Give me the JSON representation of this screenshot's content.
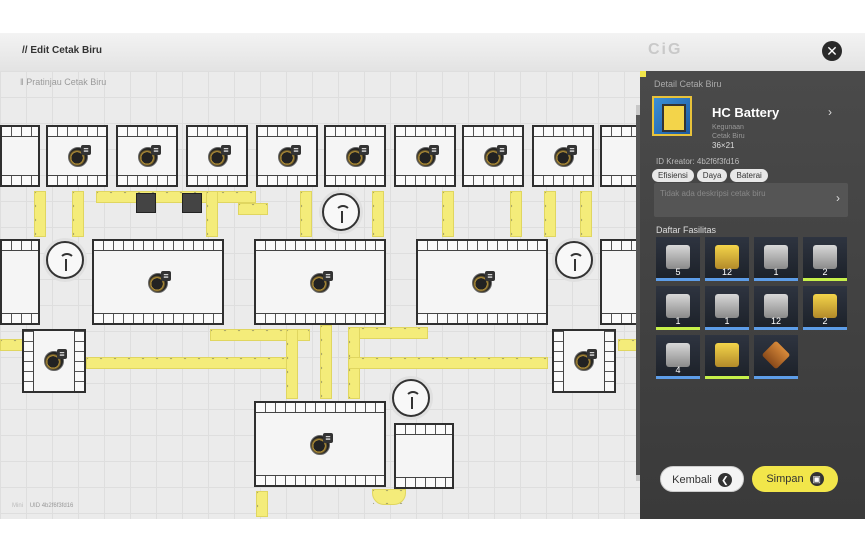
{
  "header": {
    "title": "// Edit Cetak Biru",
    "logo_text": "CiG",
    "close_label": "✕"
  },
  "canvas": {
    "preview_label": "‖ Pratinjau Cetak Biru"
  },
  "details": {
    "section_label": "Detail Cetak Biru",
    "name": "HC Battery",
    "subtitle_lines": [
      "Kegunaan",
      "Cetak Biru"
    ],
    "size": "36×21",
    "creator": "ID Kreator: 4b2f6f3fd16",
    "tags": [
      "Efisiensi",
      "Daya",
      "Baterai"
    ],
    "description_placeholder": "Tidak ada deskripsi cetak biru",
    "facilities_title": "Daftar Fasilitas",
    "facilities": [
      {
        "count": "5"
      },
      {
        "count": "12"
      },
      {
        "count": "1"
      },
      {
        "count": "2"
      },
      {
        "count": "1"
      },
      {
        "count": "1"
      },
      {
        "count": "12"
      },
      {
        "count": "2"
      },
      {
        "count": "4"
      },
      {
        "count": ""
      },
      {
        "count": ""
      }
    ]
  },
  "buttons": {
    "back_label": "Kembali",
    "save_label": "Simpan"
  },
  "footer": {
    "status": "Mini",
    "uid": "UID 4b2f6f3fd16"
  },
  "colors": {
    "belt": "#f4ec7a",
    "accent": "#f2e64a",
    "panel": "#3d3d3d"
  }
}
